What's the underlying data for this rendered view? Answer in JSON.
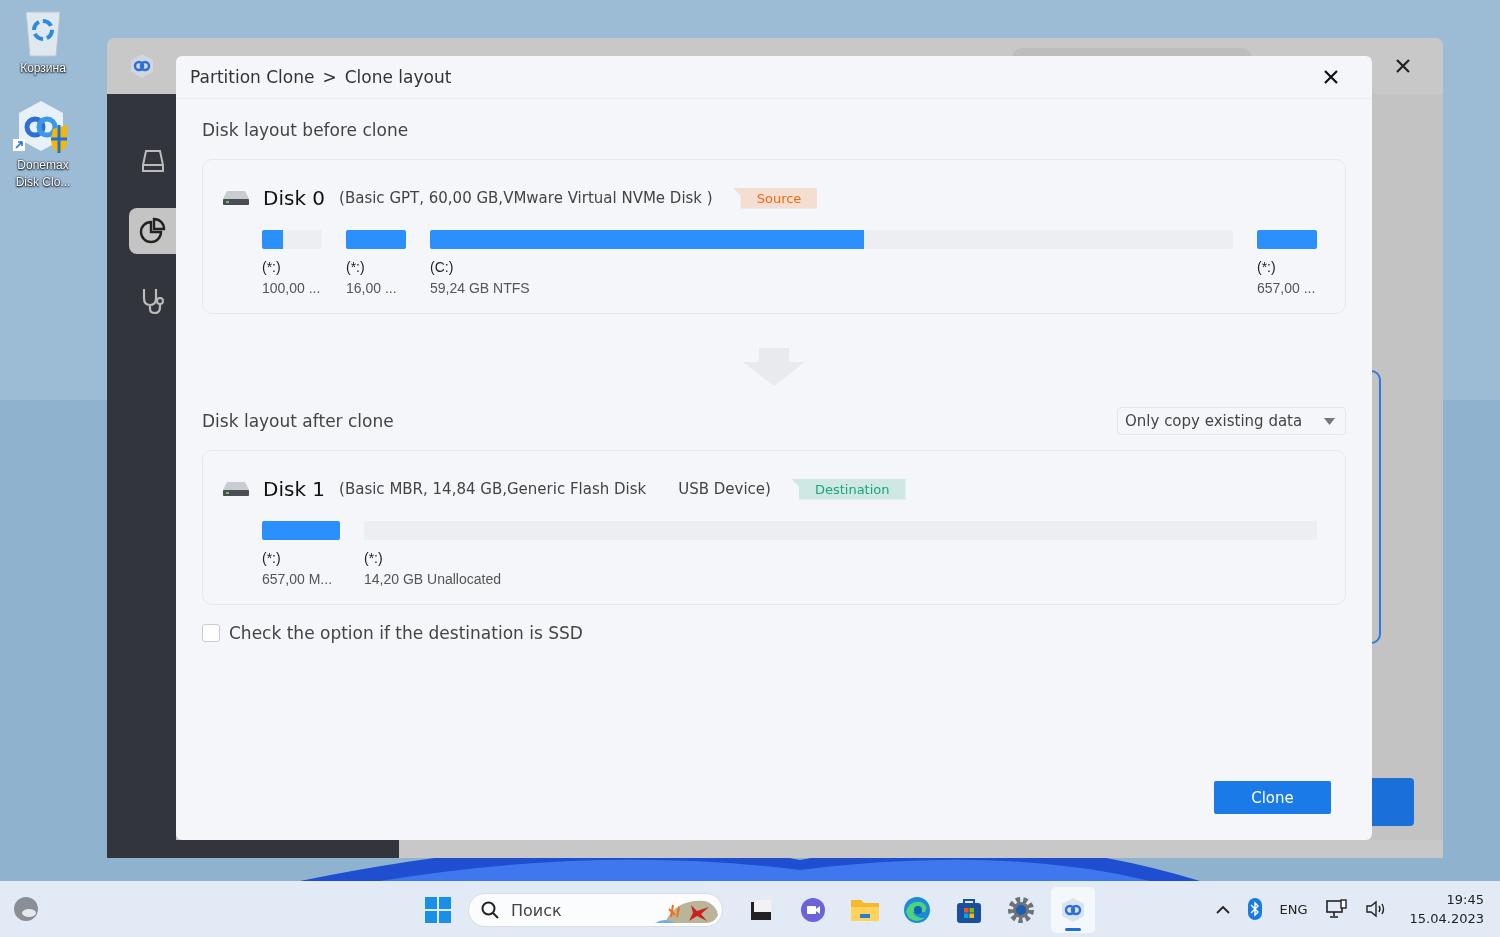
{
  "desktop": {
    "icons": [
      {
        "label": "Корзина",
        "kind": "bin"
      },
      {
        "label": "Donemax Disk Clo...",
        "kind": "app"
      }
    ]
  },
  "app_window": {
    "sidebar": [
      {
        "kind": "disk",
        "selected": false
      },
      {
        "kind": "pie",
        "selected": true
      },
      {
        "kind": "scope",
        "selected": false
      }
    ]
  },
  "dialog": {
    "breadcrumb": [
      "Partition Clone",
      ">",
      "Clone layout"
    ],
    "before": {
      "heading": "Disk layout before clone",
      "disk": {
        "name": "Disk 0",
        "info": "(Basic GPT, 60,00 GB,VMware Virtual NVMe Disk )",
        "tag": {
          "text": "Source",
          "color": "#f06a0f"
        },
        "partitions": [
          {
            "kind": "small",
            "label": "(*:)",
            "size": "100,00 ...",
            "level": 0.35
          },
          {
            "kind": "small",
            "label": "(*:)",
            "size": "16,00 ...",
            "level": 1
          },
          {
            "kind": "wide",
            "label": "(C:)",
            "size": "59,24 GB NTFS",
            "level": 0.54
          },
          {
            "kind": "small",
            "label": "(*:)",
            "size": "657,00 ...",
            "level": 1
          }
        ]
      }
    },
    "after": {
      "heading": "Disk layout after clone",
      "mode": "Only copy existing data",
      "disk": {
        "name": "Disk 1",
        "info": "(Basic MBR, 14,84 GB,Generic  Flash Disk",
        "info_2": "USB Device)",
        "tag": {
          "text": "Destination",
          "color": "#1aa57a"
        },
        "partitions": [
          {
            "kind": "medium",
            "label": "(*:)",
            "size": "657,00 M...",
            "level": 1
          },
          {
            "kind": "unallocated",
            "label": "(*:)",
            "size": "14,20 GB Unallocated"
          }
        ]
      }
    },
    "ssd_option": {
      "label": "Check the option if the destination is SSD",
      "checked": false
    },
    "button": "Clone"
  },
  "taskbar": {
    "search": {
      "placeholder": "Поиск"
    },
    "apps": [
      {
        "kind": "task",
        "selected": false
      },
      {
        "kind": "chat",
        "selected": false
      },
      {
        "kind": "folder",
        "selected": false
      },
      {
        "kind": "edge",
        "selected": false
      },
      {
        "kind": "store",
        "selected": false
      },
      {
        "kind": "gear",
        "selected": false
      },
      {
        "kind": "clone",
        "selected": true
      }
    ],
    "language": "ENG",
    "time": "19:45",
    "date": "15.04.2023"
  }
}
